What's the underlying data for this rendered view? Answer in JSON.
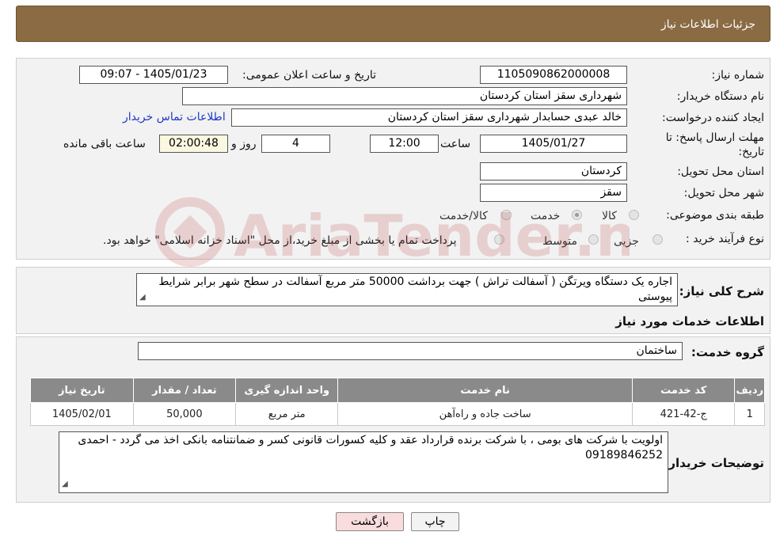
{
  "header": {
    "title": "جزئیات اطلاعات نیاز"
  },
  "info": {
    "need_number_label": "شماره نیاز:",
    "need_number": "1105090862000008",
    "announce_label": "تاریخ و ساعت اعلان عمومی:",
    "announce_value": "1405/01/23 - 09:07",
    "buyer_org_label": "نام دستگاه خریدار:",
    "buyer_org": "شهرداری سقز استان کردستان",
    "requester_label": "ایجاد کننده درخواست:",
    "requester": "خالد عبدی حسابدار شهرداری سقز استان کردستان",
    "contact_link": "اطلاعات تماس خریدار",
    "deadline_label_line1": "مهلت ارسال پاسخ: تا",
    "deadline_label_line2": "تاریخ:",
    "deadline_date": "1405/01/27",
    "time_label": "ساعت",
    "deadline_time": "12:00",
    "days_value": "4",
    "days_label": "روز و",
    "remaining_time": "02:00:48",
    "remaining_label": "ساعت باقی مانده",
    "province_label": "استان محل تحویل:",
    "province": "کردستان",
    "city_label": "شهر محل تحویل:",
    "city": "سقز",
    "category_label": "طبقه بندی موضوعی:",
    "category_options": [
      "کالا",
      "خدمت",
      "کالا/خدمت"
    ],
    "category_selected": "خدمت",
    "purchase_type_label": "نوع فرآیند خرید :",
    "purchase_options": [
      "جزیی",
      "متوسط"
    ],
    "purchase_note": "پرداخت تمام یا بخشی از مبلغ خرید،از محل \"اسناد خزانه اسلامی\" خواهد بود."
  },
  "description": {
    "label": "شرح کلی نیاز:",
    "text": "اجاره یک دستگاه ویرتگن ( آسفالت تراش ) جهت برداشت 50000 متر مربع آسفالت در سطح شهر برابر شرایط پیوستی"
  },
  "services": {
    "section_title": "اطلاعات خدمات مورد نیاز",
    "group_label": "گروه خدمت:",
    "group_value": "ساختمان",
    "columns": [
      "ردیف",
      "کد خدمت",
      "نام خدمت",
      "واحد اندازه گیری",
      "تعداد / مقدار",
      "تاریخ نیاز"
    ],
    "rows": [
      [
        "1",
        "ج-42-421",
        "ساخت جاده و راه‌آهن",
        "متر مربع",
        "50,000",
        "1405/02/01"
      ]
    ]
  },
  "buyer_notes": {
    "label": "توضیحات خریدار:",
    "text": "اولویت با شرکت های بومی ، با شرکت برنده قرارداد عقد و کلیه کسورات قانونی کسر و ضمانتنامه بانکی اخذ می گردد - احمدی 09189846252"
  },
  "buttons": {
    "print": "چاپ",
    "back": "بازگشت"
  },
  "watermark": {
    "text": "AriaTender.neT"
  },
  "colors": {
    "header": "#8b6b43",
    "table_header": "#8a8a8a",
    "link": "#1f36c7",
    "back_button": "#f9dcdc"
  }
}
